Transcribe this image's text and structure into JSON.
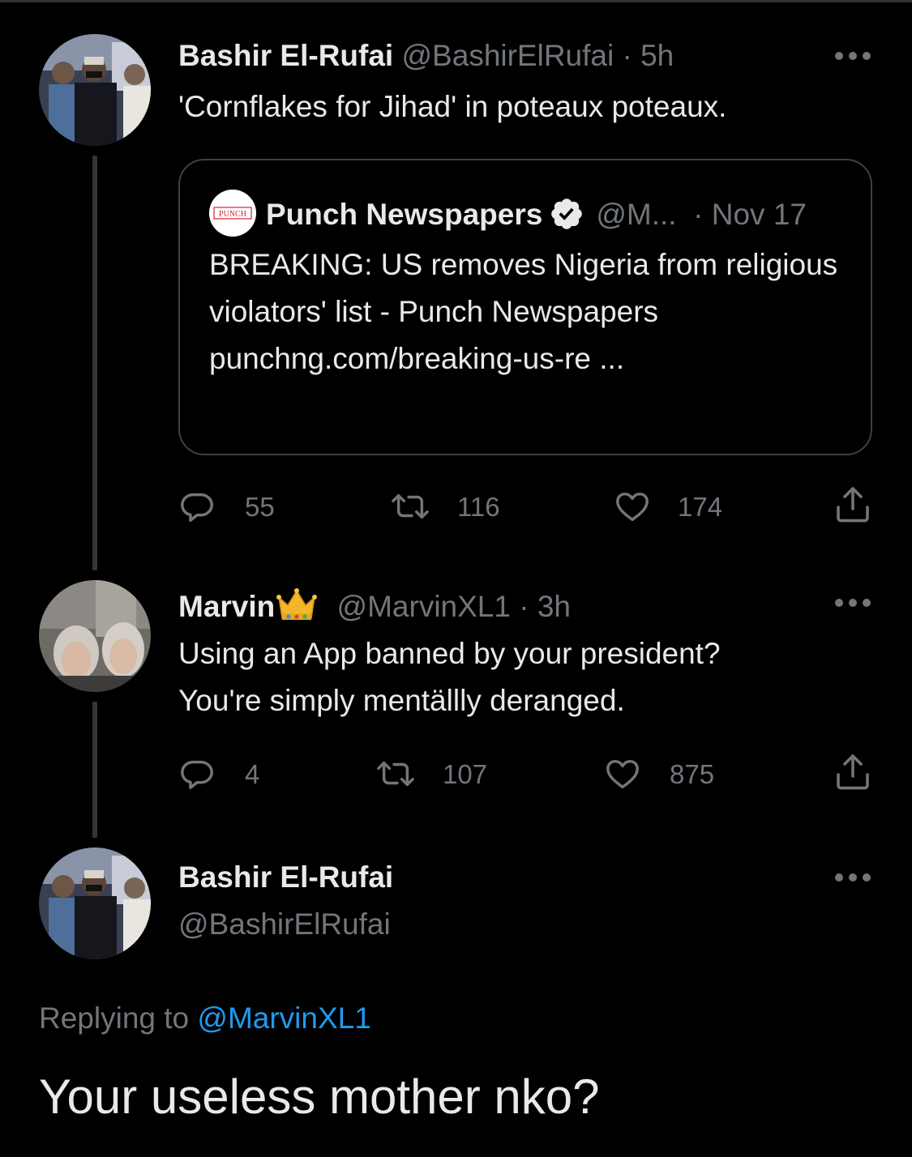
{
  "tweets": [
    {
      "name": "Bashir El-Rufai",
      "handle": "@BashirElRufai",
      "time": "5h",
      "text": "'Cornflakes for Jihad' in poteaux poteaux.",
      "quote": {
        "logo_text": "PUNCH",
        "name": "Punch Newspapers",
        "handle": "@M...",
        "date": "Nov 17",
        "text": "BREAKING: US removes Nigeria from religious violators' list - Punch Newspapers punchng.com/breaking-us-re  ..."
      },
      "replies": "55",
      "retweets": "116",
      "likes": "174"
    },
    {
      "name": "Marvin",
      "handle": "@MarvinXL1",
      "time": "3h",
      "text_line1": "Using an App banned by your president?",
      "text_line2": "You're simply mentällly deranged.",
      "replies": "4",
      "retweets": "107",
      "likes": "875"
    }
  ],
  "main_tweet": {
    "name": "Bashir El-Rufai",
    "handle": "@BashirElRufai",
    "replying_prefix": "Replying to",
    "replying_to": "@MarvinXL1",
    "text": "Your useless mother nko?"
  },
  "colors": {
    "background": "#000000",
    "text": "#e7e9ea",
    "muted": "#71767b",
    "link": "#1d9bf0",
    "border": "#3e4144"
  },
  "icons": [
    "reply-icon",
    "retweet-icon",
    "like-icon",
    "share-icon",
    "more-icon",
    "verified-badge-icon",
    "crown-emoji-icon"
  ]
}
